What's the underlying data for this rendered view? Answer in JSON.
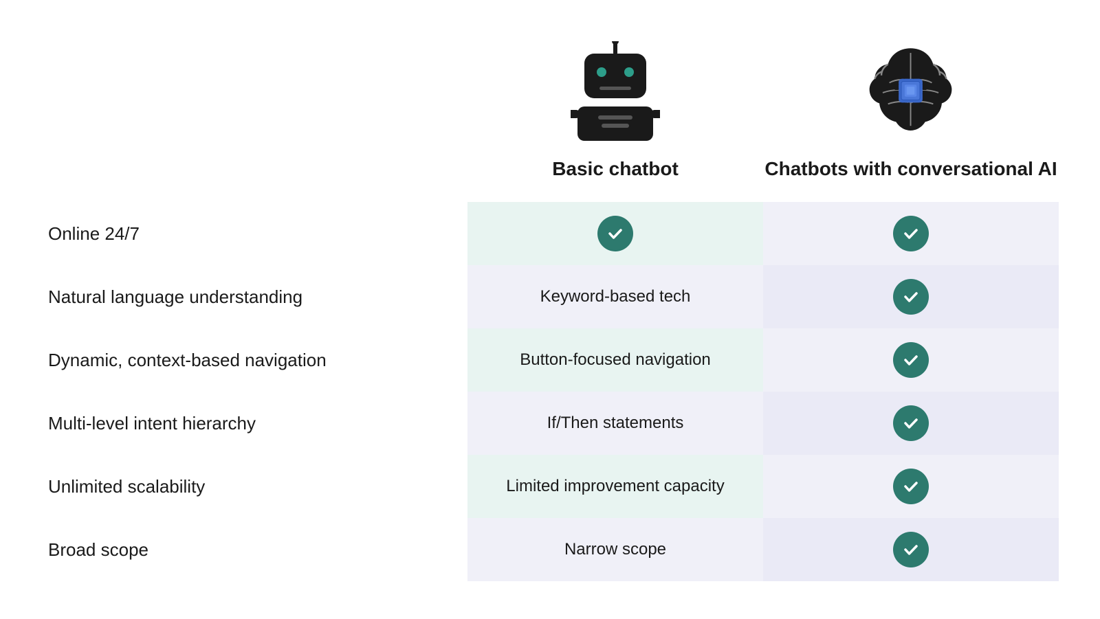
{
  "header": {
    "col_empty": "",
    "col_basic_title": "Basic chatbot",
    "col_ai_title": "Chatbots with conversational AI"
  },
  "rows": [
    {
      "feature": "Online 24/7",
      "basic": "checkmark",
      "ai": "checkmark"
    },
    {
      "feature": "Natural language understanding",
      "basic": "Keyword-based tech",
      "ai": "checkmark"
    },
    {
      "feature": "Dynamic, context-based navigation",
      "basic": "Button-focused navigation",
      "ai": "checkmark"
    },
    {
      "feature": "Multi-level intent hierarchy",
      "basic": "If/Then statements",
      "ai": "checkmark"
    },
    {
      "feature": "Unlimited scalability",
      "basic": "Limited improvement capacity",
      "ai": "checkmark"
    },
    {
      "feature": "Broad scope",
      "basic": "Narrow scope",
      "ai": "checkmark"
    }
  ]
}
